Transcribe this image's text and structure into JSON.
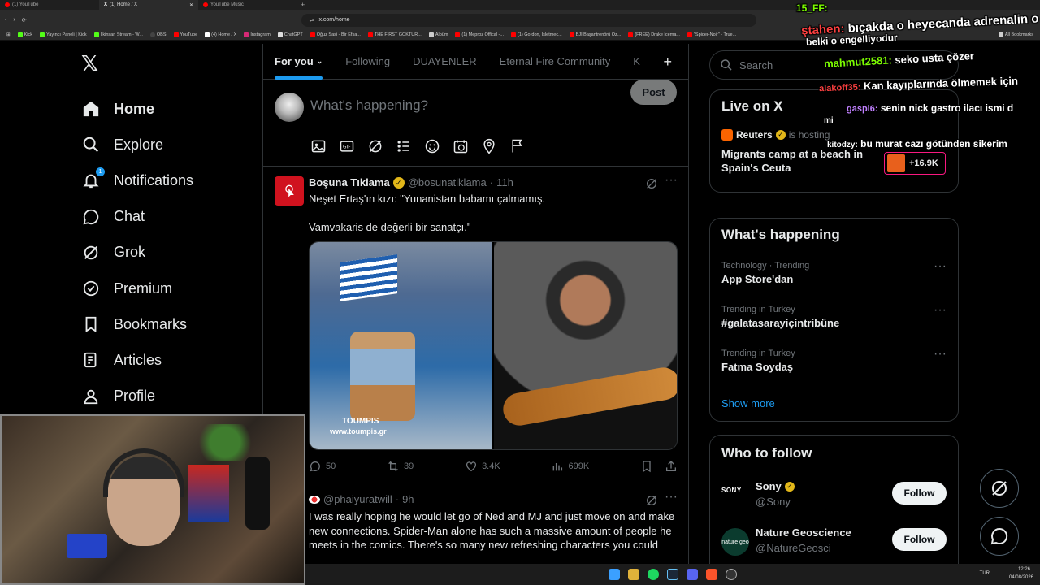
{
  "browser": {
    "tabs": [
      {
        "label": "(1) YouTube",
        "active": false
      },
      {
        "label": "(1) Home / X",
        "active": true
      },
      {
        "label": "YouTube Music",
        "active": false
      }
    ],
    "url": "x.com/home",
    "bookmarks": [
      "Kick",
      "Yayıncı Paneli | Kick",
      "Ilkinsan Stream - W...",
      "OBS",
      "YouTube",
      "(4) Home / X",
      "Instagram",
      "ChatGPT",
      "Oğuz Sasi - Bir Efsa...",
      "THE FIRST GOKTUR...",
      "Albüm",
      "(1) Meproz Offical -...",
      "(1) Gordon, İşletmec...",
      "BJI Başantrenörü Oz...",
      "(FREE) Drake Icema...",
      "\"Spider-Noir\" - True...",
      "All Bookmarks"
    ]
  },
  "sidebar": {
    "items": [
      {
        "label": "Home",
        "icon": "home-icon"
      },
      {
        "label": "Explore",
        "icon": "search-icon"
      },
      {
        "label": "Notifications",
        "icon": "bell-icon",
        "badge": "1"
      },
      {
        "label": "Chat",
        "icon": "chat-icon"
      },
      {
        "label": "Grok",
        "icon": "grok-icon"
      },
      {
        "label": "Premium",
        "icon": "premium-icon"
      },
      {
        "label": "Bookmarks",
        "icon": "bookmark-icon"
      },
      {
        "label": "Articles",
        "icon": "articles-icon"
      },
      {
        "label": "Profile",
        "icon": "profile-icon"
      }
    ]
  },
  "timeline": {
    "tabs": [
      "For you",
      "Following",
      "DUAYENLER",
      "Eternal Fire Community",
      "K"
    ],
    "compose_placeholder": "What's happening?",
    "post_label": "Post"
  },
  "tweets": [
    {
      "name": "Boşuna Tıklama",
      "handle": "@bosunatiklama",
      "time": "11h",
      "text1": "Neşet Ertaş'ın kızı: \"Yunanistan babamı çalmamış.",
      "text2": "Vamvakaris de değerli bir sanatçı.\"",
      "image_caption": "www.toumpis.gr",
      "image_caption2": "TOUMPIS",
      "replies": "50",
      "reposts": "39",
      "likes": "3.4K",
      "views": "699K"
    },
    {
      "handle": "@phaiyuratwill",
      "time": "9h",
      "text": "I was really hoping he would let go of Ned and MJ and just move on and make new connections. Spider-Man alone has such a massive amount of people he meets in the comics. There's so many new refreshing characters you could"
    }
  ],
  "right": {
    "search_placeholder": "Search",
    "live": {
      "title": "Live on X",
      "host": "Reuters",
      "host_suffix": "is hosting",
      "headline": "Migrants camp at a beach in Spain's Ceuta",
      "viewers": "+16.9K"
    },
    "happening": {
      "title": "What's happening",
      "trends": [
        {
          "context": "Technology · Trending",
          "name": "App Store'dan"
        },
        {
          "context": "Trending in Turkey",
          "name": "#galatasarayiçintribüne"
        },
        {
          "context": "Trending in Turkey",
          "name": "Fatma Soydaş"
        }
      ],
      "show_more": "Show more"
    },
    "who_to_follow": {
      "title": "Who to follow",
      "accounts": [
        {
          "name": "Sony",
          "handle": "@Sony",
          "logo": "SONY"
        },
        {
          "name": "Nature Geoscience",
          "handle": "@NatureGeosci",
          "logo": "nature geo"
        }
      ],
      "follow_label": "Follow"
    }
  },
  "chat_overlay": [
    {
      "user": "15_FF:",
      "msg": "",
      "color": "#7cfc00"
    },
    {
      "user": "ştahen:",
      "msg": "bıçakda o heyecanda adrenalin o",
      "color": "#ff4040"
    },
    {
      "user": "",
      "msg": "belki o engelliyodur",
      "color": "#ffffff"
    },
    {
      "user": "mahmut2581:",
      "msg": "seko usta çözer",
      "color": "#7cfc00"
    },
    {
      "user": "alakoff35:",
      "msg": "Kan kayıplarında ölmemek için",
      "color": "#ff4040"
    },
    {
      "user": "gaspi6:",
      "msg": "senin nick gastro ilacı ismi d",
      "color": "#c080ff"
    },
    {
      "user": "",
      "msg": "mi",
      "color": "#ffffff"
    },
    {
      "user": "kitodzy:",
      "msg": "bu murat cazı götünden sikerim",
      "color": "#ffffff"
    }
  ],
  "taskbar": {
    "lang": "TUR",
    "time": "12:26",
    "date": "04/08/2026"
  }
}
